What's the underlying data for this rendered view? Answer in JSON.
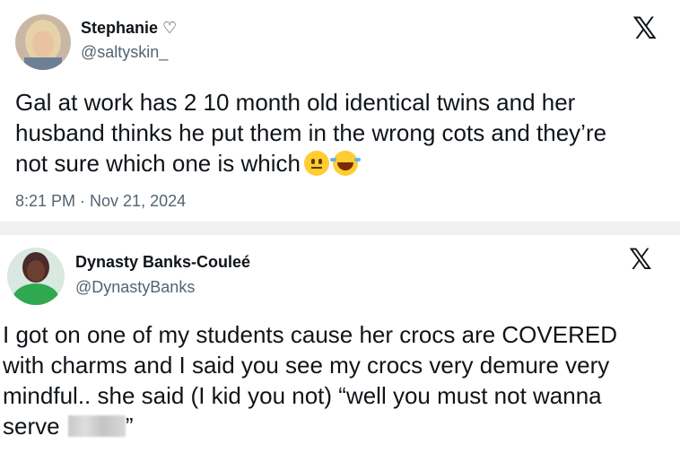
{
  "tweets": [
    {
      "name": "Stephanie ♡",
      "handle": "@saltyskin_",
      "text_line1": "Gal at work has 2 10 month old identical twins and her",
      "text_line2": "husband thinks he put them in the wrong cots and they’re",
      "text_line3": "not sure which one is which",
      "emojis": [
        "neutral-face-emoji",
        "laughing-tears-emoji"
      ],
      "timestamp": "8:21 PM · Nov 21, 2024",
      "x_logo": "𝕏"
    },
    {
      "name": "Dynasty Banks-Couleé",
      "handle": "@DynastyBanks",
      "text_line1": "I got on one of my students cause her crocs are COVERED",
      "text_line2": "with charms and I said you see my crocs very demure very",
      "text_line3": "mindful.. she said (I kid you not)  “well you must not wanna",
      "text_line4_prefix": "serve",
      "text_line4_suffix": "”",
      "x_logo": "𝕏"
    }
  ]
}
